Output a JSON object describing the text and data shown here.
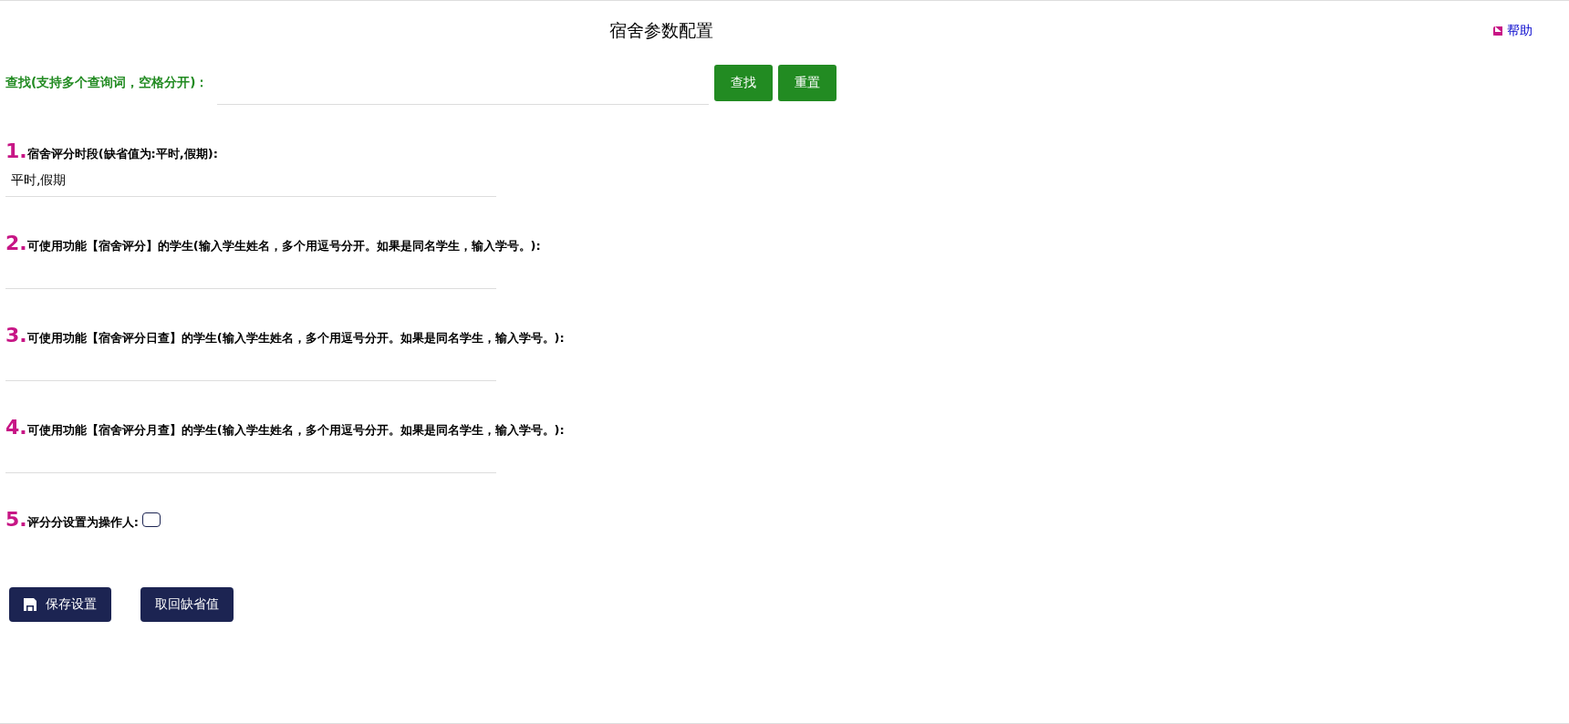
{
  "page": {
    "title": "宿舍参数配置",
    "help_link": "帮助"
  },
  "search": {
    "label": "查找(支持多个查询词，空格分开)：",
    "buttons": [
      "查找",
      "重置"
    ]
  },
  "settings": [
    {
      "kind": "text",
      "number": "1.",
      "label": "宿舍评分时段(缺省值为:平时,假期):",
      "value": "平时,假期"
    },
    {
      "kind": "text",
      "number": "2.",
      "label": "可使用功能【宿舍评分】的学生(输入学生姓名，多个用逗号分开。如果是同名学生，输入学号。):"
    },
    {
      "kind": "text",
      "number": "3.",
      "label": "可使用功能【宿舍评分日查】的学生(输入学生姓名，多个用逗号分开。如果是同名学生，输入学号。):"
    },
    {
      "kind": "text",
      "number": "4.",
      "label": "可使用功能【宿舍评分月查】的学生(输入学生姓名，多个用逗号分开。如果是同名学生，输入学号。):"
    },
    {
      "kind": "checkbox",
      "number": "5.",
      "label": "评分分设置为操作人:",
      "checked": false
    }
  ],
  "actions": [
    {
      "kind": "save",
      "label": "保存设置"
    },
    {
      "kind": "plain",
      "label": "取回缺省值"
    }
  ]
}
